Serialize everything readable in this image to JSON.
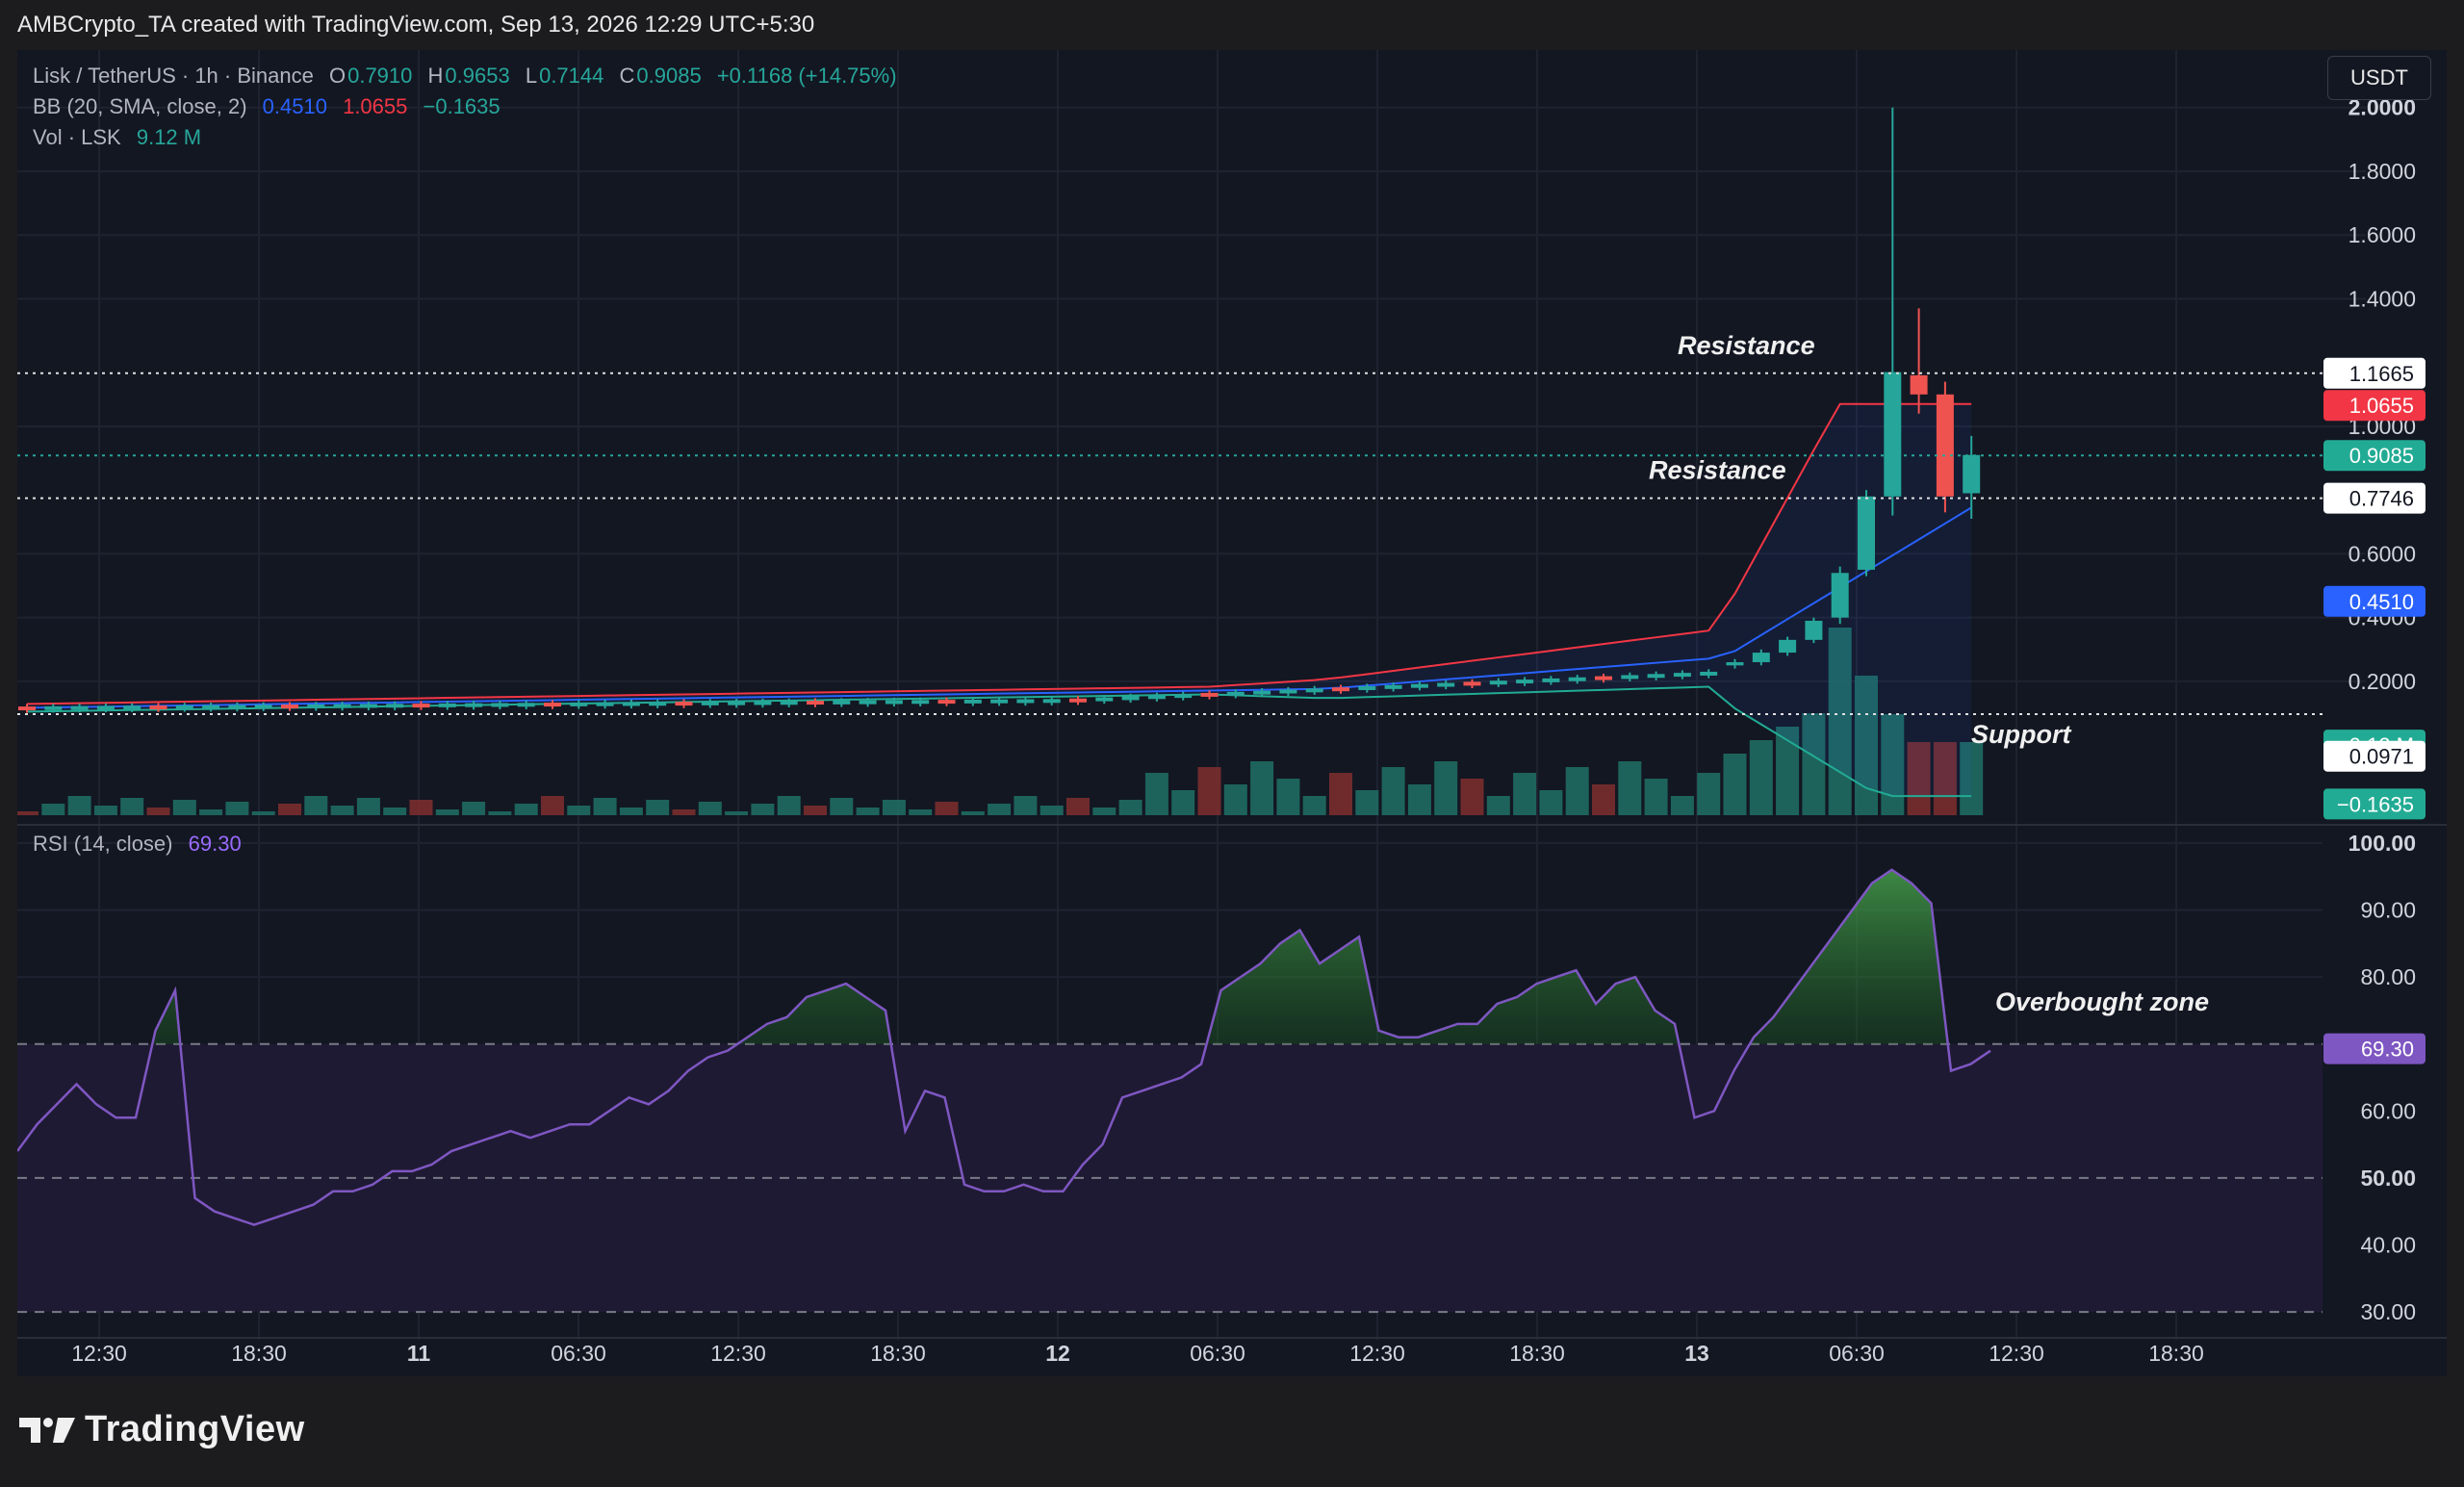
{
  "credit": "AMBCrypto_TA created with TradingView.com, Sep 13, 2026 12:29 UTC+5:30",
  "legend": {
    "symbol": "Lisk / TetherUS · 1h · Binance",
    "o_label": "O",
    "o": "0.7910",
    "h_label": "H",
    "h": "0.9653",
    "l_label": "L",
    "l": "0.7144",
    "c_label": "C",
    "c": "0.9085",
    "change": "+0.1168 (+14.75%)",
    "bb_label": "BB (20, SMA, close, 2)",
    "bb_basis": "0.4510",
    "bb_upper": "1.0655",
    "bb_lower": "−0.1635",
    "vol_label": "Vol · LSK",
    "vol": "9.12 M",
    "rsi_label": "RSI (14, close)",
    "rsi": "69.30"
  },
  "currency_button": "USDT",
  "brand": "TradingView",
  "colors": {
    "up": "#26a69a",
    "down": "#ef5350",
    "bb_upper": "#f23645",
    "bb_basis": "#2962ff",
    "bb_lower": "#22ab94",
    "rsi": "#7e57c2",
    "background": "#131722"
  },
  "chart_data": {
    "type": "candlestick",
    "symbol": "LSK/USDT",
    "interval": "1h",
    "x_ticks": [
      "12:30",
      "18:30",
      "11",
      "06:30",
      "12:30",
      "18:30",
      "12",
      "06:30",
      "12:30",
      "18:30",
      "13",
      "06:30",
      "12:30",
      "18:30"
    ],
    "price_axis": {
      "ticks": [
        "2.0000",
        "1.8000",
        "1.6000",
        "1.4000",
        "1.0000",
        "0.6000",
        "0.4000",
        "0.2000"
      ],
      "ylim": [
        -0.22,
        2.12
      ]
    },
    "price_tags": [
      {
        "value": "1.1665",
        "style": "white"
      },
      {
        "value": "1.0655",
        "style": "red"
      },
      {
        "value": "0.9085",
        "style": "teal"
      },
      {
        "value": "0.7746",
        "style": "white"
      },
      {
        "value": "0.4510",
        "style": "blue"
      },
      {
        "value": "9.12 M",
        "style": "teal"
      },
      {
        "value": "0.0971",
        "style": "white"
      },
      {
        "value": "−0.1635",
        "style": "teal"
      }
    ],
    "levels": [
      {
        "label": "Resistance",
        "value": 1.1665
      },
      {
        "label": "Resistance",
        "value": 0.7746
      },
      {
        "label": "Support",
        "value": 0.0971
      }
    ],
    "candles_tail": [
      {
        "o": 0.25,
        "h": 0.27,
        "l": 0.24,
        "c": 0.26
      },
      {
        "o": 0.26,
        "h": 0.3,
        "l": 0.25,
        "c": 0.29
      },
      {
        "o": 0.29,
        "h": 0.34,
        "l": 0.28,
        "c": 0.33
      },
      {
        "o": 0.33,
        "h": 0.4,
        "l": 0.32,
        "c": 0.39
      },
      {
        "o": 0.4,
        "h": 0.56,
        "l": 0.38,
        "c": 0.54
      },
      {
        "o": 0.55,
        "h": 0.8,
        "l": 0.53,
        "c": 0.78
      },
      {
        "o": 0.78,
        "h": 2.0,
        "l": 0.72,
        "c": 1.17
      },
      {
        "o": 1.16,
        "h": 1.37,
        "l": 1.04,
        "c": 1.1
      },
      {
        "o": 1.1,
        "h": 1.14,
        "l": 0.73,
        "c": 0.78
      },
      {
        "o": 0.79,
        "h": 0.97,
        "l": 0.71,
        "c": 0.91
      }
    ],
    "rsi_axis": {
      "ticks": [
        "100.00",
        "90.00",
        "80.00",
        "60.00",
        "50.00",
        "40.00",
        "30.00"
      ],
      "ylim": [
        28,
        102
      ],
      "overbought": 70,
      "mid": 50,
      "oversold": 30
    },
    "rsi_tag": "69.30",
    "rsi_values": [
      54,
      58,
      61,
      64,
      61,
      59,
      59,
      72,
      78,
      47,
      45,
      44,
      43,
      44,
      45,
      46,
      48,
      48,
      49,
      51,
      51,
      52,
      54,
      55,
      56,
      57,
      56,
      57,
      58,
      58,
      60,
      62,
      61,
      63,
      66,
      68,
      69,
      71,
      73,
      74,
      77,
      78,
      79,
      77,
      75,
      57,
      63,
      62,
      49,
      48,
      48,
      49,
      48,
      48,
      52,
      55,
      62,
      63,
      64,
      65,
      67,
      78,
      80,
      82,
      85,
      87,
      82,
      84,
      86,
      72,
      71,
      71,
      72,
      73,
      73,
      76,
      77,
      79,
      80,
      81,
      76,
      79,
      80,
      75,
      73,
      59,
      60,
      66,
      71,
      74,
      78,
      82,
      86,
      90,
      94,
      96,
      94,
      91,
      66,
      67,
      69
    ],
    "annotation": "Overbought zone"
  }
}
